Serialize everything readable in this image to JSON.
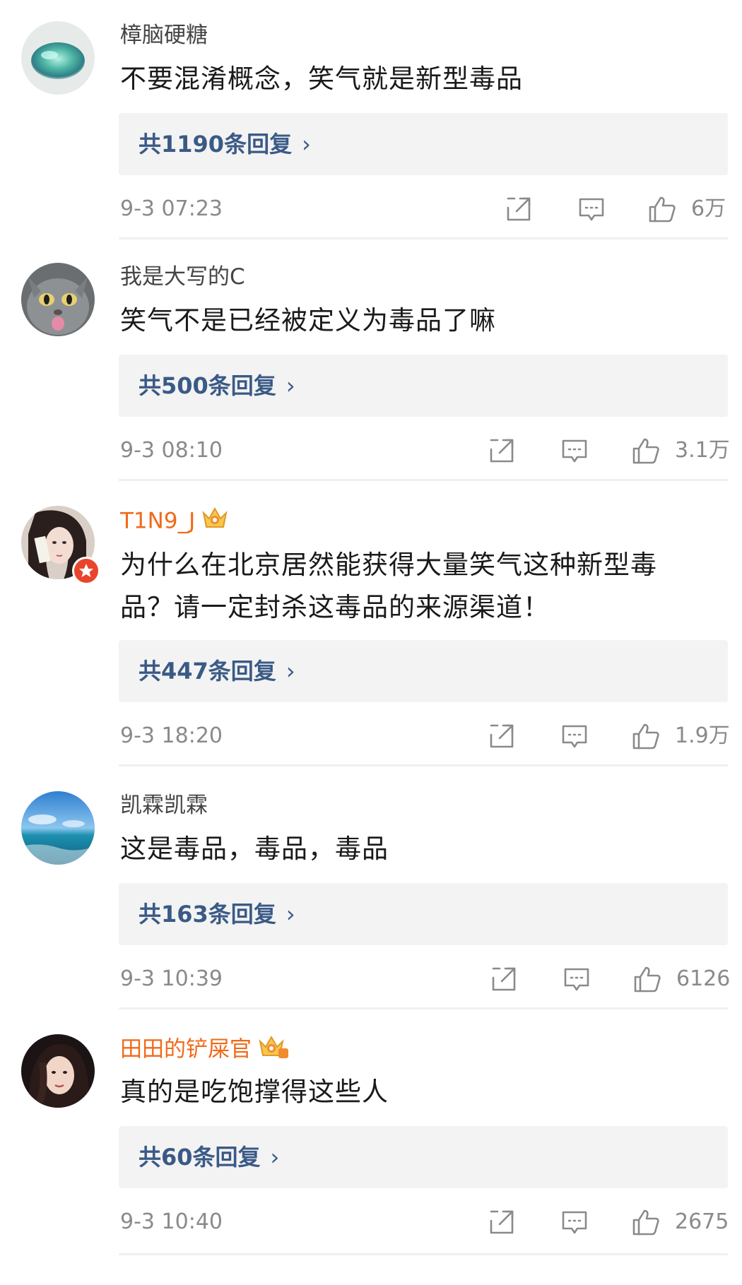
{
  "comments": [
    {
      "username": "樟脑硬糖",
      "content": "不要混淆概念，笑气就是新型毒品",
      "reply_count": "共1190条回复",
      "time": "9-3 07:23",
      "likes": "6万"
    },
    {
      "username": "我是大写的C",
      "content": "笑气不是已经被定义为毒品了嘛",
      "reply_count": "共500条回复",
      "time": "9-3 08:10",
      "likes": "3.1万"
    },
    {
      "username": "T1N9_J",
      "content": "为什么在北京居然能获得大量笑气这种新型毒品？请一定封杀这毒品的来源渠道！",
      "reply_count": "共447条回复",
      "time": "9-3 18:20",
      "likes": "1.9万"
    },
    {
      "username": "凯霖凯霖",
      "content": "这是毒品，毒品，毒品",
      "reply_count": "共163条回复",
      "time": "9-3 10:39",
      "likes": "6126"
    },
    {
      "username": "田田的铲屎官",
      "content": "真的是吃饱撑得这些人",
      "reply_count": "共60条回复",
      "time": "9-3 10:40",
      "likes": "2675"
    }
  ],
  "icons": {
    "chevron": "›",
    "share": "share-icon",
    "comment": "comment-icon",
    "like": "thumbs-up-icon"
  },
  "colors": {
    "vip_username": "#f06a1a",
    "reply_link": "#3a5a86",
    "meta_text": "#8a8a8a",
    "reply_background": "#f3f3f3"
  }
}
